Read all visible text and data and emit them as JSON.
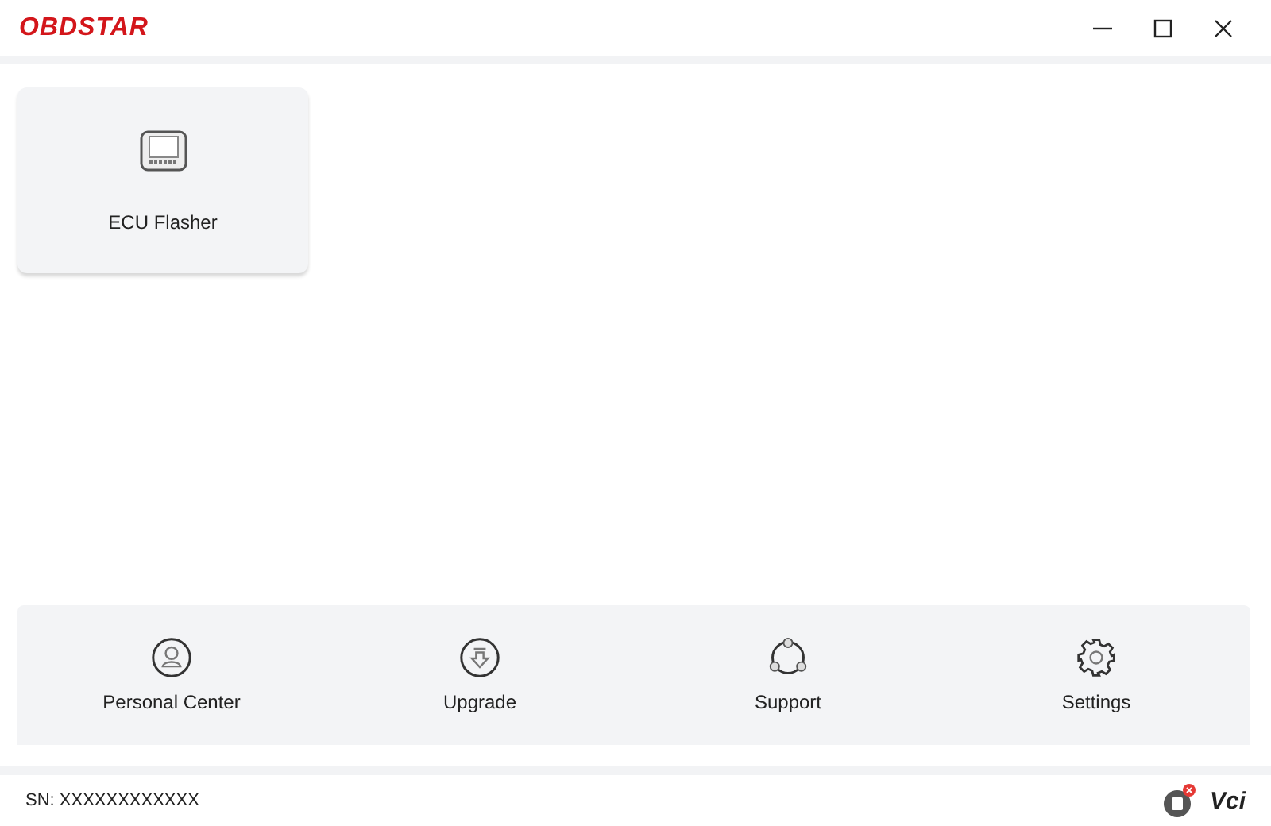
{
  "window": {
    "logo": "OBDSTAR"
  },
  "apps": [
    {
      "label": "ECU Flasher"
    }
  ],
  "nav": [
    {
      "kind": "person",
      "label": "Personal Center"
    },
    {
      "kind": "upgrade",
      "label": "Upgrade"
    },
    {
      "kind": "support",
      "label": "Support"
    },
    {
      "kind": "settings",
      "label": "Settings"
    }
  ],
  "status_bar": {
    "serial": "SN: XXXXXXXXXXXX",
    "vci_connected": false,
    "vci_logo": "Vci"
  }
}
